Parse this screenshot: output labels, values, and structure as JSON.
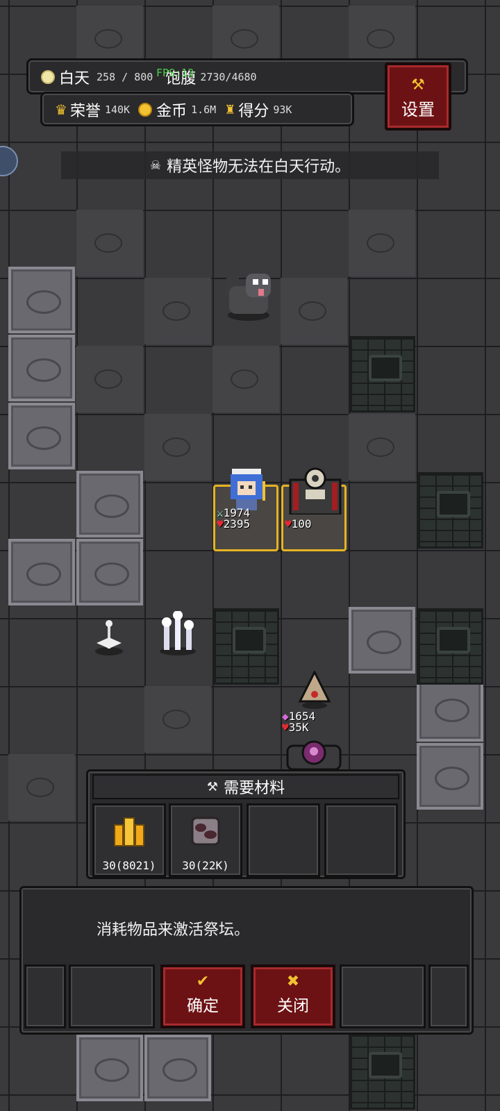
{
  "hud": {
    "time_label": "白天",
    "time_value": "258 / 800",
    "fps": "FPS:13",
    "satiety_label": "饱腹",
    "satiety_value": "2730/4680",
    "honor_label": "荣誉",
    "honor_value": "140K",
    "gold_label": "金币",
    "gold_value": "1.6M",
    "score_label": "得分",
    "score_value": "93K",
    "settings_label": "设置"
  },
  "message": {
    "icon": "skull-icon",
    "text": "精英怪物无法在白天行动。"
  },
  "units": {
    "player_attack": "1974",
    "player_hp": "2395",
    "altar_hp": "100",
    "enemy_attack": "1654",
    "enemy_hp": "35K"
  },
  "materials": {
    "title": "需要材料",
    "icon": "wrench-icon",
    "slots": [
      {
        "icon": "gold-bars-icon",
        "label": "30(8021)"
      },
      {
        "icon": "ore-icon",
        "label": "30(22K)"
      },
      {
        "icon": "",
        "label": ""
      },
      {
        "icon": "",
        "label": ""
      }
    ]
  },
  "dialog": {
    "text": "消耗物品来激活祭坛。",
    "confirm_label": "确定",
    "close_label": "关闭"
  },
  "colors": {
    "accent_red": "#6d1214",
    "panel": "#2a292b",
    "gold": "#f1c232",
    "fps_green": "#4cd34c",
    "selection_yellow": "#e6b422"
  }
}
